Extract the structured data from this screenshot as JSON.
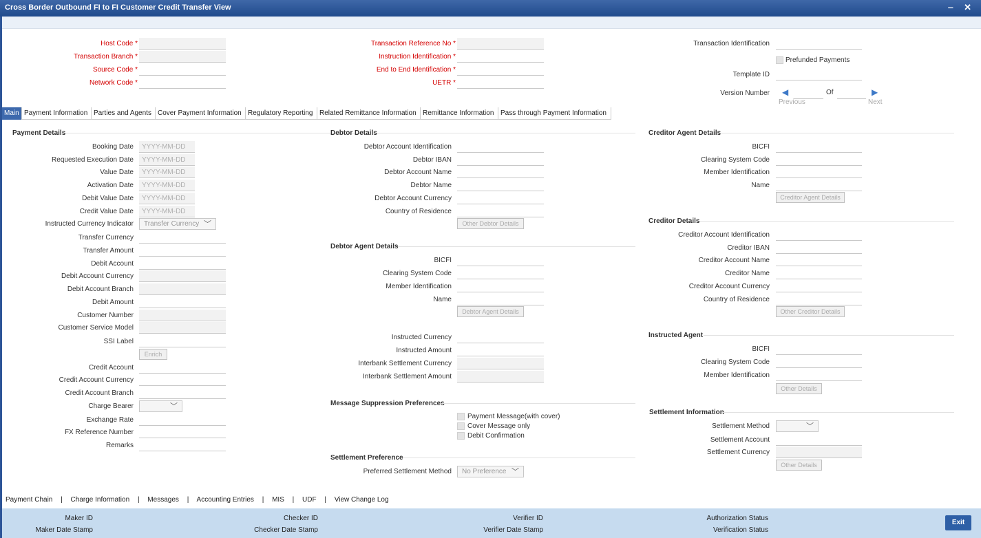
{
  "window": {
    "title": "Cross Border Outbound FI to FI Customer Credit Transfer View",
    "controls": "‒ ✕"
  },
  "header": {
    "col1": [
      {
        "label": "Host Code",
        "required": "*",
        "value": ""
      },
      {
        "label": "Transaction Branch",
        "required": "*",
        "value": ""
      },
      {
        "label": "Source Code",
        "required": "*",
        "value": ""
      },
      {
        "label": "Network Code",
        "required": "*",
        "value": ""
      }
    ],
    "col2": [
      {
        "label": "Transaction Reference No",
        "required": "*",
        "value": ""
      },
      {
        "label": "Instruction Identification",
        "required": "*",
        "value": ""
      },
      {
        "label": "End to End Identification",
        "required": "*",
        "value": ""
      },
      {
        "label": "UETR",
        "required": "*",
        "value": ""
      }
    ],
    "col3": {
      "transaction_identification": "Transaction Identification",
      "prefunded_payments": "Prefunded Payments",
      "template_id": "Template ID",
      "version_number": "Version Number",
      "of": "Of",
      "previous": "Previous",
      "next": "Next"
    }
  },
  "tabs": [
    "Main",
    "Payment Information",
    "Parties and Agents",
    "Cover Payment Information",
    "Regulatory Reporting",
    "Related Remittance Information",
    "Remittance Information",
    "Pass through Payment Information"
  ],
  "payment_details": {
    "title": "Payment Details",
    "date_placeholder": "YYYY-MM-DD",
    "booking_date": "Booking Date",
    "requested_execution_date": "Requested Execution Date",
    "value_date": "Value Date",
    "activation_date": "Activation Date",
    "debit_value_date": "Debit Value Date",
    "credit_value_date": "Credit Value Date",
    "instructed_currency_indicator": "Instructed Currency Indicator",
    "instructed_currency_indicator_value": "Transfer Currency",
    "transfer_currency": "Transfer Currency",
    "transfer_amount": "Transfer Amount",
    "debit_account": "Debit Account",
    "debit_account_currency": "Debit Account Currency",
    "debit_account_branch": "Debit Account Branch",
    "debit_amount": "Debit Amount",
    "customer_number": "Customer Number",
    "customer_service_model": "Customer Service Model",
    "ssi_label": "SSI Label",
    "enrich": "Enrich",
    "credit_account": "Credit Account",
    "credit_account_currency": "Credit Account Currency",
    "credit_account_branch": "Credit Account Branch",
    "charge_bearer": "Charge Bearer",
    "exchange_rate": "Exchange Rate",
    "fx_reference_number": "FX Reference Number",
    "remarks": "Remarks"
  },
  "debtor_details": {
    "title": "Debtor Details",
    "account_identification": "Debtor Account Identification",
    "iban": "Debtor IBAN",
    "account_name": "Debtor Account Name",
    "name": "Debtor Name",
    "account_currency": "Debtor Account Currency",
    "country_of_residence": "Country of Residence",
    "other_button": "Other Debtor Details"
  },
  "debtor_agent": {
    "title": "Debtor Agent Details",
    "bicfi": "BICFI",
    "clearing_system_code": "Clearing System Code",
    "member_identification": "Member Identification",
    "name": "Name",
    "button": "Debtor Agent Details"
  },
  "instructed": {
    "instructed_currency": "Instructed Currency",
    "instructed_amount": "Instructed Amount",
    "interbank_settlement_currency": "Interbank Settlement Currency",
    "interbank_settlement_amount": "Interbank Settlement Amount"
  },
  "message_suppression": {
    "title": "Message Suppression Preferences",
    "payment_message": "Payment Message(with cover)",
    "cover_message": "Cover Message only",
    "debit_confirmation": "Debit Confirmation"
  },
  "settlement_preference": {
    "title": "Settlement Preference",
    "preferred_method": "Preferred Settlement Method",
    "preferred_method_value": "No Preference"
  },
  "creditor_agent": {
    "title": "Creditor Agent Details",
    "bicfi": "BICFI",
    "clearing_system_code": "Clearing System Code",
    "member_identification": "Member Identification",
    "name": "Name",
    "button": "Creditor Agent Details"
  },
  "creditor_details": {
    "title": "Creditor Details",
    "account_identification": "Creditor Account Identification",
    "iban": "Creditor IBAN",
    "account_name": "Creditor Account Name",
    "name": "Creditor Name",
    "account_currency": "Creditor Account Currency",
    "country_of_residence": "Country of Residence",
    "other_button": "Other Creditor Details"
  },
  "instructed_agent": {
    "title": "Instructed Agent",
    "bicfi": "BICFI",
    "clearing_system_code": "Clearing System Code",
    "member_identification": "Member Identification",
    "other_button": "Other Details"
  },
  "settlement_information": {
    "title": "Settlement Information",
    "method": "Settlement Method",
    "account": "Settlement Account",
    "currency": "Settlement Currency",
    "other_button": "Other Details"
  },
  "bottom_nav": [
    "Payment Chain",
    "Charge Information",
    "Messages",
    "Accounting Entries",
    "MIS",
    "UDF",
    "View Change Log"
  ],
  "nav_separator": "|",
  "footer": {
    "maker_id": "Maker ID",
    "maker_date_stamp": "Maker Date Stamp",
    "checker_id": "Checker ID",
    "checker_date_stamp": "Checker Date Stamp",
    "verifier_id": "Verifier ID",
    "verifier_date_stamp": "Verifier Date Stamp",
    "authorization_status": "Authorization Status",
    "verification_status": "Verification Status",
    "exit": "Exit"
  },
  "icons": {
    "left_arrow": "◀",
    "right_arrow": "▶",
    "chevron": "﹀"
  }
}
